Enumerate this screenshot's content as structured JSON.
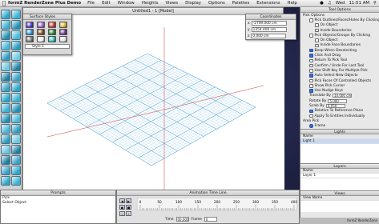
{
  "menubar": {
    "apple": "",
    "app_name": "formZ RenderZone Plus Demo",
    "menus": [
      "File",
      "Edit",
      "Window",
      "Heights",
      "Views",
      "Display",
      "Options",
      "Palettes",
      "Extensions",
      "Help"
    ],
    "day": "Wed",
    "time": "11:51 AM"
  },
  "main_window": {
    "title": "Untitled1 - 1 [Model]",
    "status": {
      "zoom": "100.0 %"
    }
  },
  "surface_styles": {
    "title": "Surface Styles",
    "style_label": "Style 1",
    "swatch_colors": [
      "#5b3ad6",
      "#a86fd6",
      "#d43e3e",
      "#d6b93a",
      "#3a9bd6",
      "#8a4f2e",
      "#2e8a3a",
      "#6e3a8a",
      "#7f7f7f",
      "#f0f0f0",
      "#3ac0c0",
      "#e0e0e0"
    ]
  },
  "coordinates": {
    "title": "Coordinates",
    "x": "-2709.000 cm",
    "y": "1354.400 cm",
    "z": "0.000 cm"
  },
  "tool_options": {
    "title": "Tool Options",
    "pick_options_label": "Pick Options",
    "items": [
      {
        "label": "Pick Outlines/Faces/Holes By Clicking",
        "checked": false
      },
      {
        "label": "On Object",
        "checked": false
      },
      {
        "label": "Inside Boundaries",
        "checked": false
      },
      {
        "label": "Pick Objects/Groups By Clicking",
        "checked": false
      },
      {
        "label": "On Object",
        "checked": false
      },
      {
        "label": "Inside Face Boundaries",
        "checked": false
      },
      {
        "label": "Beep When Deselecting",
        "checked": true
      },
      {
        "label": "Click And Drag",
        "checked": true
      },
      {
        "label": "Return To Pick Tool",
        "checked": false
      },
      {
        "label": "Confirm / Undo For Last Tool",
        "checked": false
      },
      {
        "label": "Use Shift Key For Multiple Pick",
        "checked": false
      },
      {
        "label": "Auto Select New Objects",
        "checked": true
      },
      {
        "label": "Pick Faces Of Controlled Objects",
        "checked": false
      },
      {
        "label": "Show Pick Cursor",
        "checked": false
      },
      {
        "label": "Use Nudge Keys",
        "checked": true
      }
    ],
    "translate_label": "Translate By",
    "translate_value": "10.000 cm",
    "rotate_label": "Rotate By",
    "rotate_value": "5.000",
    "scale_label": "Scale By",
    "scale_value": "0.050",
    "relative_label": "Relative To Reference Plane",
    "apply_label": "Apply To Entities Individually",
    "area_pick_label": "Area Pick",
    "frame_label": "Frame",
    "lights_title": "Lights",
    "lights_header": "Name",
    "lights": [
      "Light 1"
    ],
    "layers_title": "Layers",
    "layers_header": "Name",
    "layers": [
      "Layer 1"
    ],
    "views_title": "Views",
    "views_header": "View Name"
  },
  "prompts": {
    "title": "Prompts",
    "lines": [
      "Pick",
      "Select Object"
    ]
  },
  "animation": {
    "title": "Animation Time Line",
    "ticks": [
      "0",
      "50",
      "100",
      "150",
      "200",
      "250",
      "300",
      "350",
      "400"
    ],
    "time_label": "Time",
    "time_value": "00.000",
    "frame_label": "Frame",
    "frame_value": "0"
  },
  "dock_label": "formZ RenderZone"
}
